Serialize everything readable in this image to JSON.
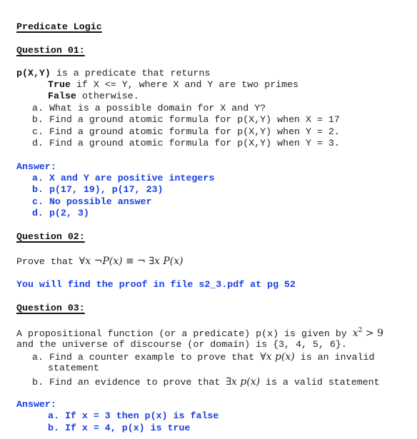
{
  "title": "Predicate Logic",
  "q1": {
    "heading": "Question 01:",
    "intro_pred": "p(X,Y)",
    "intro_rest": " is a predicate that returns",
    "true_word": "True",
    "true_rest": " if X <= Y, where X and Y are two primes",
    "false_word": "False",
    "false_rest": " otherwise.",
    "items": [
      "a. What is a possible domain for X and Y?",
      "b. Find a ground atomic formula for p(X,Y) when X = 17",
      "c. Find a ground atomic formula for p(X,Y) when Y = 2.",
      "d. Find a ground atomic formula for p(X,Y) when Y = 3."
    ],
    "answer_label": "Answer:",
    "answers": [
      "a. X and Y are positive integers",
      "b. p(17, 19), p(17, 23)",
      "c. No possible answer",
      "d. p(2, 3)"
    ]
  },
  "q2": {
    "heading": "Question 02:",
    "prove_text": "Prove that ",
    "formula_left_forall": "∀",
    "formula_left_var": "x ",
    "formula_left_neg": "¬",
    "formula_left_pred": "P(x)",
    "formula_equiv": " ≡ ",
    "formula_right_neg": "¬ ",
    "formula_right_exists": "∃",
    "formula_right_var": "x ",
    "formula_right_pred": "P(x)",
    "answer_text": "You will find the proof in file s2_3.pdf at pg 52"
  },
  "q3": {
    "heading": "Question 03:",
    "line1_text": "A propositional function (or a predicate) p(x) is given by ",
    "line1_math_base": "x",
    "line1_math_exp": "2",
    "line1_math_rest": " > 9",
    "line2_text": "and the universe of discourse (or domain) is {3, 4, 5, 6}.",
    "item_a_prefix": "a. Find a counter example to prove that ",
    "item_a_quant": "∀",
    "item_a_math": "x p(x)",
    "item_a_suffix": " is an invalid",
    "item_a_cont": "statement",
    "item_b_prefix": "b. Find an evidence to prove that ",
    "item_b_quant": "∃",
    "item_b_math": "x p(x)",
    "item_b_suffix": " is a valid statement",
    "answer_label": "Answer:",
    "answers": [
      "a. If x = 3 then p(x) is false",
      "b. If x = 4, p(x) is true"
    ]
  }
}
